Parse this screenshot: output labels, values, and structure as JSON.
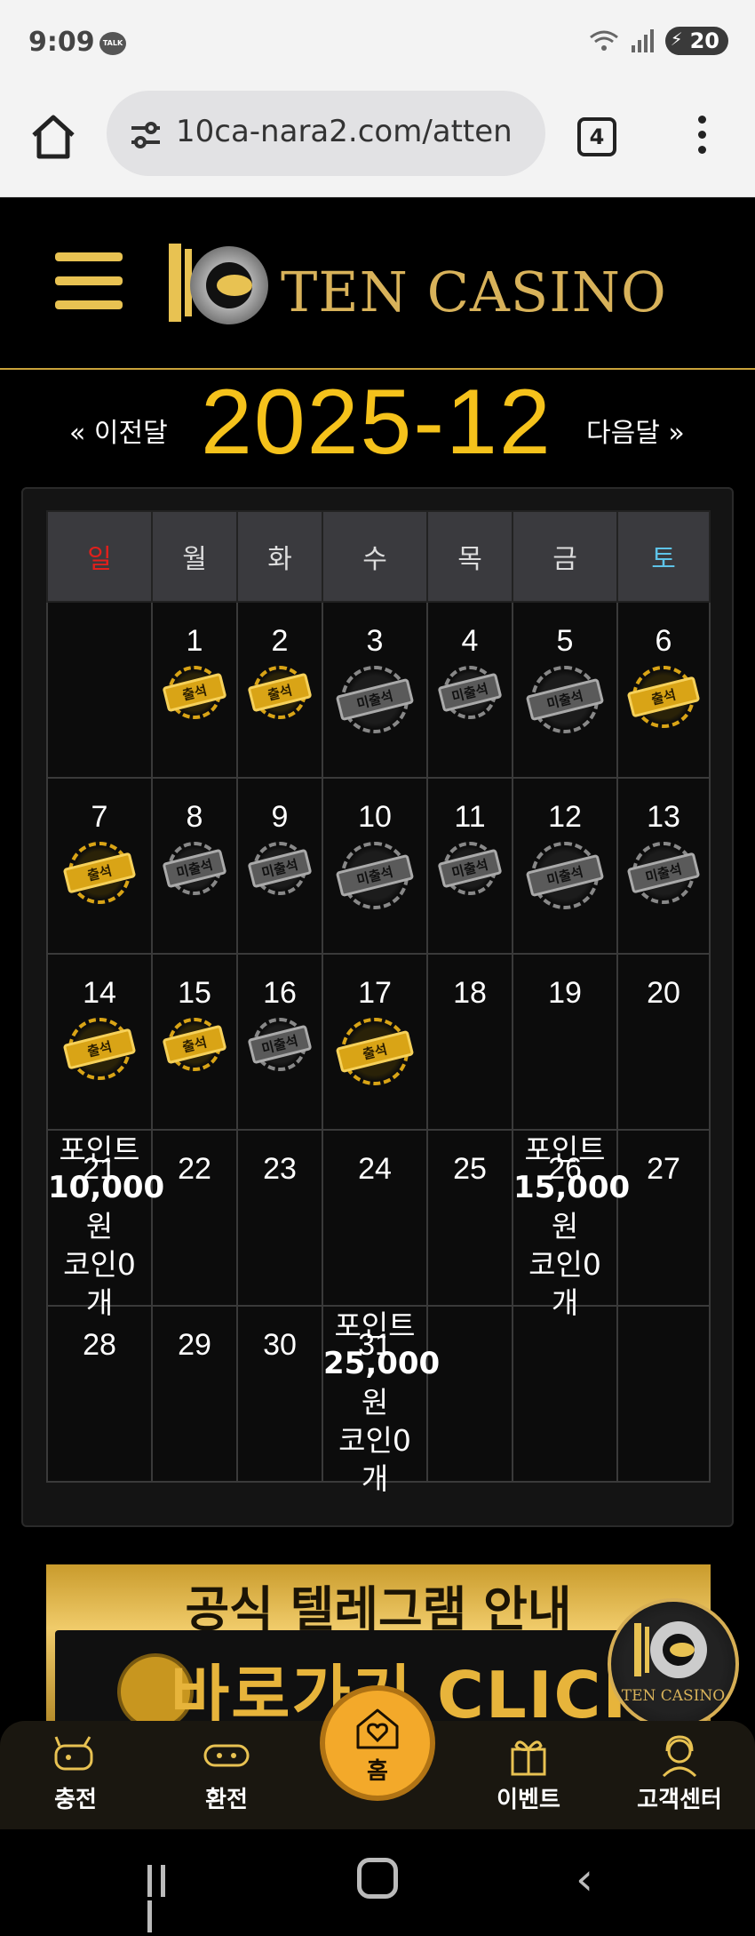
{
  "status": {
    "time": "9:09",
    "talk_badge": "TALK",
    "battery": "20"
  },
  "browser": {
    "url": "10ca-nara2.com/atten",
    "tab_count": "4"
  },
  "site": {
    "logo_text": "TEN CASINO"
  },
  "month_nav": {
    "prev": "« 이전달",
    "title": "2025-12",
    "next": "다음달 »"
  },
  "calendar": {
    "weekdays": [
      "일",
      "월",
      "화",
      "수",
      "목",
      "금",
      "토"
    ],
    "attend_label": "출석",
    "absent_label": "미출석",
    "weeks": [
      [
        {
          "day": ""
        },
        {
          "day": "1",
          "status": "attend"
        },
        {
          "day": "2",
          "status": "attend"
        },
        {
          "day": "3",
          "status": "absent"
        },
        {
          "day": "4",
          "status": "absent"
        },
        {
          "day": "5",
          "status": "absent"
        },
        {
          "day": "6",
          "status": "attend"
        }
      ],
      [
        {
          "day": "7",
          "status": "attend"
        },
        {
          "day": "8",
          "status": "absent"
        },
        {
          "day": "9",
          "status": "absent"
        },
        {
          "day": "10",
          "status": "absent"
        },
        {
          "day": "11",
          "status": "absent"
        },
        {
          "day": "12",
          "status": "absent"
        },
        {
          "day": "13",
          "status": "absent"
        }
      ],
      [
        {
          "day": "14",
          "status": "attend"
        },
        {
          "day": "15",
          "status": "attend"
        },
        {
          "day": "16",
          "status": "absent"
        },
        {
          "day": "17",
          "status": "attend"
        },
        {
          "day": "18"
        },
        {
          "day": "19"
        },
        {
          "day": "20"
        }
      ],
      [
        {
          "day": "21",
          "reward": {
            "point_label": "포인트",
            "amount": "10,000",
            "unit": "원",
            "coin": "코인0",
            "coin_unit": "개"
          }
        },
        {
          "day": "22"
        },
        {
          "day": "23"
        },
        {
          "day": "24"
        },
        {
          "day": "25"
        },
        {
          "day": "26",
          "reward": {
            "point_label": "포인트",
            "amount": "15,000",
            "unit": "원",
            "coin": "코인0",
            "coin_unit": "개"
          }
        },
        {
          "day": "27"
        }
      ],
      [
        {
          "day": "28"
        },
        {
          "day": "29"
        },
        {
          "day": "30"
        },
        {
          "day": "31",
          "reward": {
            "point_label": "포인트",
            "amount": "25,000",
            "unit": "원",
            "coin": "코인0",
            "coin_unit": "개"
          }
        },
        {
          "day": ""
        },
        {
          "day": ""
        },
        {
          "day": ""
        }
      ]
    ]
  },
  "banner": {
    "title": "공식 텔레그램 안내",
    "cta": "바로가기 CLICK",
    "float_logo": "TEN CASINO"
  },
  "bottom_nav": {
    "items": [
      {
        "label": "충전",
        "icon": "charge-icon"
      },
      {
        "label": "환전",
        "icon": "exchange-icon"
      },
      {
        "label": "홈",
        "icon": "home-heart-icon"
      },
      {
        "label": "이벤트",
        "icon": "gift-icon"
      },
      {
        "label": "고객센터",
        "icon": "support-icon"
      }
    ]
  },
  "colors": {
    "gold": "#f5c21b",
    "sunday": "#e0201c",
    "saturday": "#5ec3e8",
    "home_button": "#f3a92a"
  }
}
